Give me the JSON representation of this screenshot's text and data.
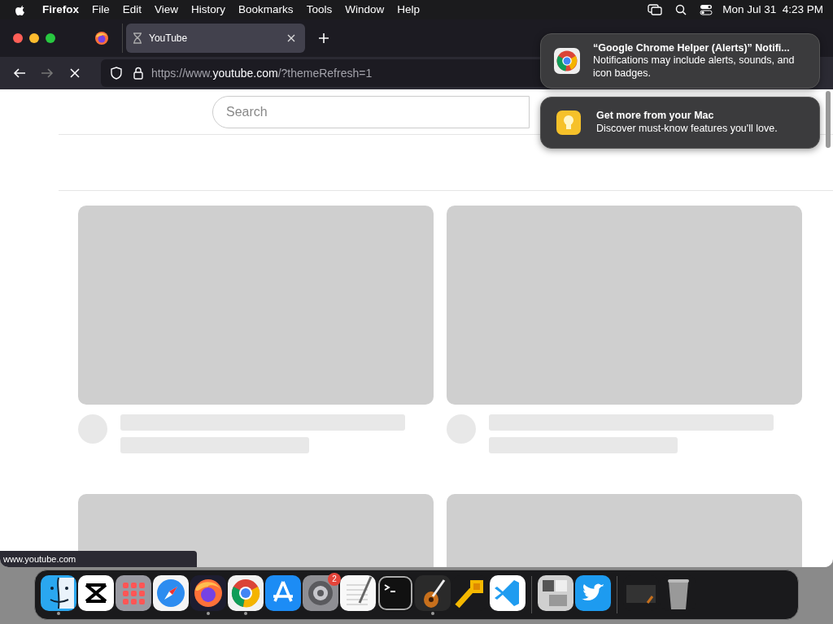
{
  "menubar": {
    "app_name": "Firefox",
    "menus": [
      "File",
      "Edit",
      "View",
      "History",
      "Bookmarks",
      "Tools",
      "Window",
      "Help"
    ],
    "clock": "Mon Jul 31  4:23 PM"
  },
  "tabs": [
    {
      "title": "YouTube",
      "selected": true
    }
  ],
  "navigation": {
    "forward_disabled": true
  },
  "address_bar": {
    "prefix": "https://www.",
    "host": "youtube.com",
    "suffix": "/?themeRefresh=1"
  },
  "page": {
    "search": {
      "placeholder": "Search"
    }
  },
  "status_url": "www.youtube.com",
  "notifications": [
    {
      "kind": "chrome",
      "title": "“Google Chrome Helper (Alerts)” Notifi...",
      "body": "Notifications may include alerts, sounds, and icon badges."
    },
    {
      "kind": "tips",
      "title": "Get more from your Mac",
      "body": "Discover must-know features you'll love."
    }
  ],
  "dock": [
    {
      "kind": "finder",
      "running": true
    },
    {
      "kind": "capcut",
      "running": false
    },
    {
      "kind": "launchpad",
      "running": false
    },
    {
      "kind": "safari",
      "running": false
    },
    {
      "kind": "firefox",
      "running": true
    },
    {
      "kind": "chrome",
      "running": true
    },
    {
      "kind": "appstore",
      "running": false
    },
    {
      "kind": "settings",
      "running": false,
      "badge": "2"
    },
    {
      "kind": "textedit",
      "running": false
    },
    {
      "kind": "terminal",
      "running": false
    },
    {
      "kind": "garageband",
      "running": true
    },
    {
      "kind": "arrow",
      "running": false
    },
    {
      "kind": "vscode",
      "running": false
    },
    {
      "kind": "separator"
    },
    {
      "kind": "bootcamp",
      "running": false
    },
    {
      "kind": "twitter",
      "running": false
    },
    {
      "kind": "separator"
    },
    {
      "kind": "window",
      "running": false
    },
    {
      "kind": "trash",
      "running": false
    }
  ]
}
